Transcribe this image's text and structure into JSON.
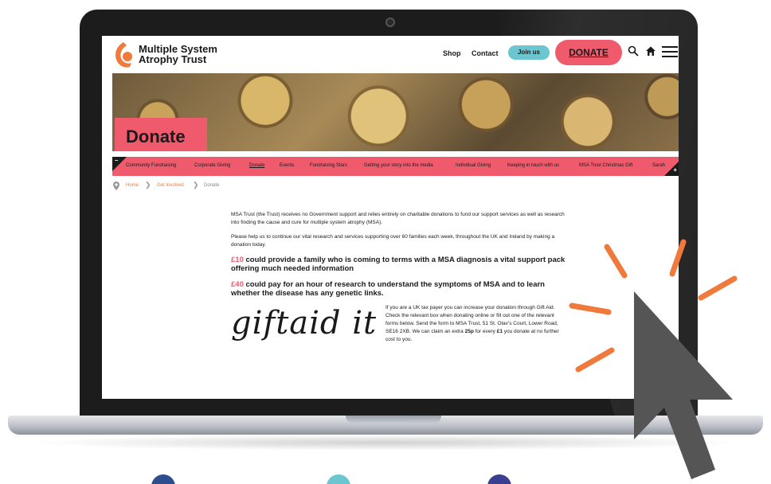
{
  "site": {
    "logo_line1": "Multiple System",
    "logo_line2": "Atrophy Trust",
    "nav": {
      "shop": "Shop",
      "contact": "Contact",
      "join": "Join us",
      "donate": "DONATE"
    },
    "icons": {
      "search": "search-icon",
      "home": "home-icon",
      "menu": "menu-icon"
    }
  },
  "hero": {
    "title": "Donate"
  },
  "subnav": {
    "items": [
      "Community Fundraising",
      "Corporate Giving",
      "Donate",
      "Events",
      "Fundraising Stars",
      "Getting your story into the media",
      "Individual Giving",
      "Keeping in touch with us",
      "MSA Trust Christmas Gift",
      "Sarah"
    ],
    "active": "Donate"
  },
  "breadcrumb": {
    "home": "Home",
    "parent": "Get Involved",
    "current": "Donate"
  },
  "content": {
    "intro": "MSA Trust (the Trust) receives no Government support and relies entirely on charitable donations to fund our support services as well as research into finding the cause and cure for multiple system atrophy (MSA).",
    "help": "Please help us to continue our vital research and services supporting over 60 families each week, throughout the UK and Ireland by making a donation today.",
    "amount1": "£10",
    "text1": "could provide a family who is coming to terms with a MSA diagnosis a vital support pack offering much needed information",
    "amount2": "£40",
    "text2": "could pay for an hour of research to understand the symptoms of MSA and to learn whether the disease has any genetic links.",
    "giftaid_logo": "giftaid it",
    "giftaid_text_a": "If you are a UK tax payer you can increase your donation through Gift Aid. Check the relevant box when donating online or fill out one of the relevant forms below. Send the form to MSA Trust, 51 St. Olav’s Court, Lower Road, SE16 2XB. We can claim an extra ",
    "giftaid_bold1": "25p",
    "giftaid_text_b": " for every ",
    "giftaid_bold2": "£1",
    "giftaid_text_c": " you donate at no further cost to you."
  },
  "colors": {
    "accent_pink": "#ef5b6d",
    "accent_teal": "#6cc6cf",
    "accent_orange": "#ef7a3c",
    "cursor_gray": "#555555"
  }
}
